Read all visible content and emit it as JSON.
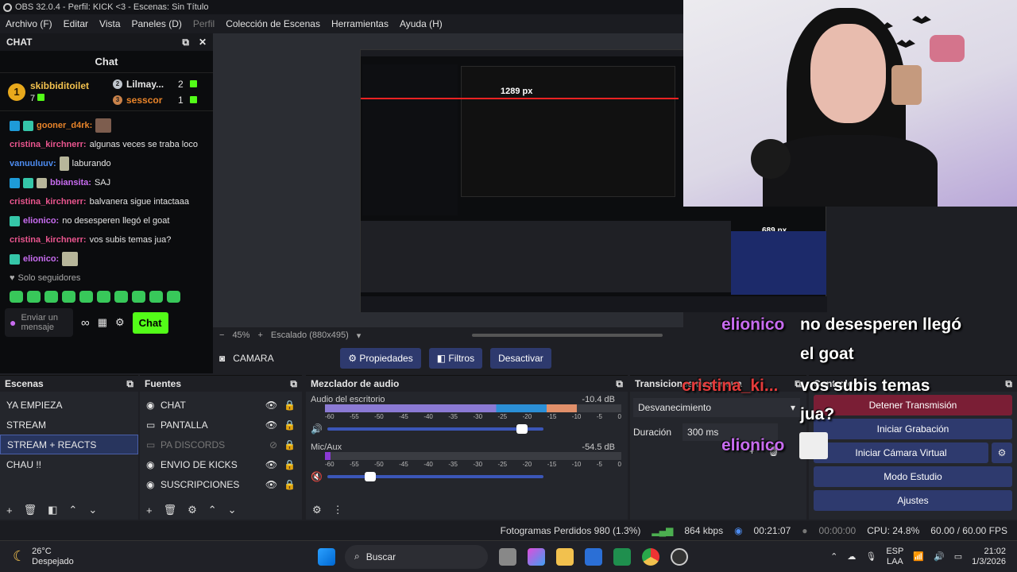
{
  "window": {
    "title": "OBS 32.0.4 - Perfil: KICK <3 - Escenas: Sin Título"
  },
  "menu": [
    "Archivo (F)",
    "Editar",
    "Vista",
    "Paneles (D)",
    "Perfil",
    "Colección de Escenas",
    "Herramientas",
    "Ayuda (H)"
  ],
  "chat_dock": {
    "header": "CHAT",
    "title": "Chat",
    "leaderboard": [
      {
        "rank": "1",
        "name": "skibbiditoilet",
        "count": "7"
      },
      {
        "rank": "2",
        "name": "Lilmay...",
        "count": "2"
      },
      {
        "rank": "3",
        "name": "sesscor",
        "count": "1"
      }
    ],
    "messages": [
      {
        "user": "gooner_d4rk:",
        "text": "",
        "color": "#e8842a"
      },
      {
        "user": "cristina_kirchnerr:",
        "text": "algunas veces se traba loco",
        "color": "#e9558e"
      },
      {
        "user": "vanuuluuv:",
        "text": "laburando",
        "color": "#4d8cf0"
      },
      {
        "user": "bbiansita:",
        "text": "SAJ",
        "color": "#c86cf0"
      },
      {
        "user": "cristina_kirchnerr:",
        "text": "balvanera sigue intactaaa",
        "color": "#e9558e"
      },
      {
        "user": "elionico:",
        "text": "no desesperen llegó el goat",
        "color": "#c86cf0"
      },
      {
        "user": "cristina_kirchnerr:",
        "text": "vos subis temas jua?",
        "color": "#e9558e"
      },
      {
        "user": "elionico:",
        "text": "",
        "color": "#c86cf0"
      }
    ],
    "followers_only": "Solo seguidores",
    "input_placeholder": "Enviar un mensaje",
    "send_label": "Chat"
  },
  "preview": {
    "zoom": "45%",
    "scaling": "Escalado (880x495)",
    "nested_label": "1289 px",
    "nested_label2": "689 px"
  },
  "source_toolbar": {
    "source_name": "CAMARA",
    "properties": "Propiedades",
    "filters": "Filtros",
    "deactivate": "Desactivar"
  },
  "overlay": {
    "line1_user": "elionico",
    "line1_text": "no desesperen llegó",
    "line2_text": "el goat",
    "line3_user": "cristina_ki...",
    "line3_text": "vos subis temas",
    "line4_text": "jua?",
    "line5_user": "elionico"
  },
  "scenes": {
    "header": "Escenas",
    "items": [
      "YA EMPIEZA",
      "STREAM",
      "STREAM + REACTS",
      "CHAU !!"
    ],
    "selected": "STREAM + REACTS"
  },
  "sources": {
    "header": "Fuentes",
    "items": [
      "CHAT",
      "PANTALLA",
      "PA DISCORDS",
      "ENVIO DE KICKS",
      "SUSCRIPCIONES"
    ]
  },
  "mixer": {
    "header": "Mezclador de audio",
    "ticks": [
      "-60",
      "-55",
      "-50",
      "-45",
      "-40",
      "-35",
      "-30",
      "-25",
      "-20",
      "-15",
      "-10",
      "-5",
      "0"
    ],
    "channels": [
      {
        "name": "Audio del escritorio",
        "db": "-10.4 dB",
        "level": 0.85,
        "muted": false,
        "volume": 0.9
      },
      {
        "name": "Mic/Aux",
        "db": "-54.5 dB",
        "level": 0.02,
        "muted": true,
        "volume": 0.2
      }
    ]
  },
  "transitions": {
    "header": "Transiciones de escena",
    "type": "Desvanecimiento",
    "duration_label": "Duración",
    "duration": "300 ms"
  },
  "controls": {
    "header": "Controles",
    "buttons": [
      "Detener Transmisión",
      "Iniciar Grabación",
      "Iniciar Cámara Virtual",
      "Modo Estudio",
      "Ajustes"
    ]
  },
  "status": {
    "dropped": "Fotogramas Perdidos 980 (1.3%)",
    "kbps": "864 kbps",
    "stream_time": "00:21:07",
    "rec_time": "00:00:00",
    "cpu": "CPU: 24.8%",
    "fps": "60.00 / 60.00 FPS"
  },
  "taskbar": {
    "weather_temp": "26°C",
    "weather_desc": "Despejado",
    "search": "Buscar",
    "lang": "ESP",
    "lang2": "LAA",
    "time": "21:02",
    "date": "1/3/2026"
  },
  "colors": {
    "accent": "#2e3a6e",
    "kick_green": "#53fc18",
    "stop_red": "#7a1e35"
  }
}
